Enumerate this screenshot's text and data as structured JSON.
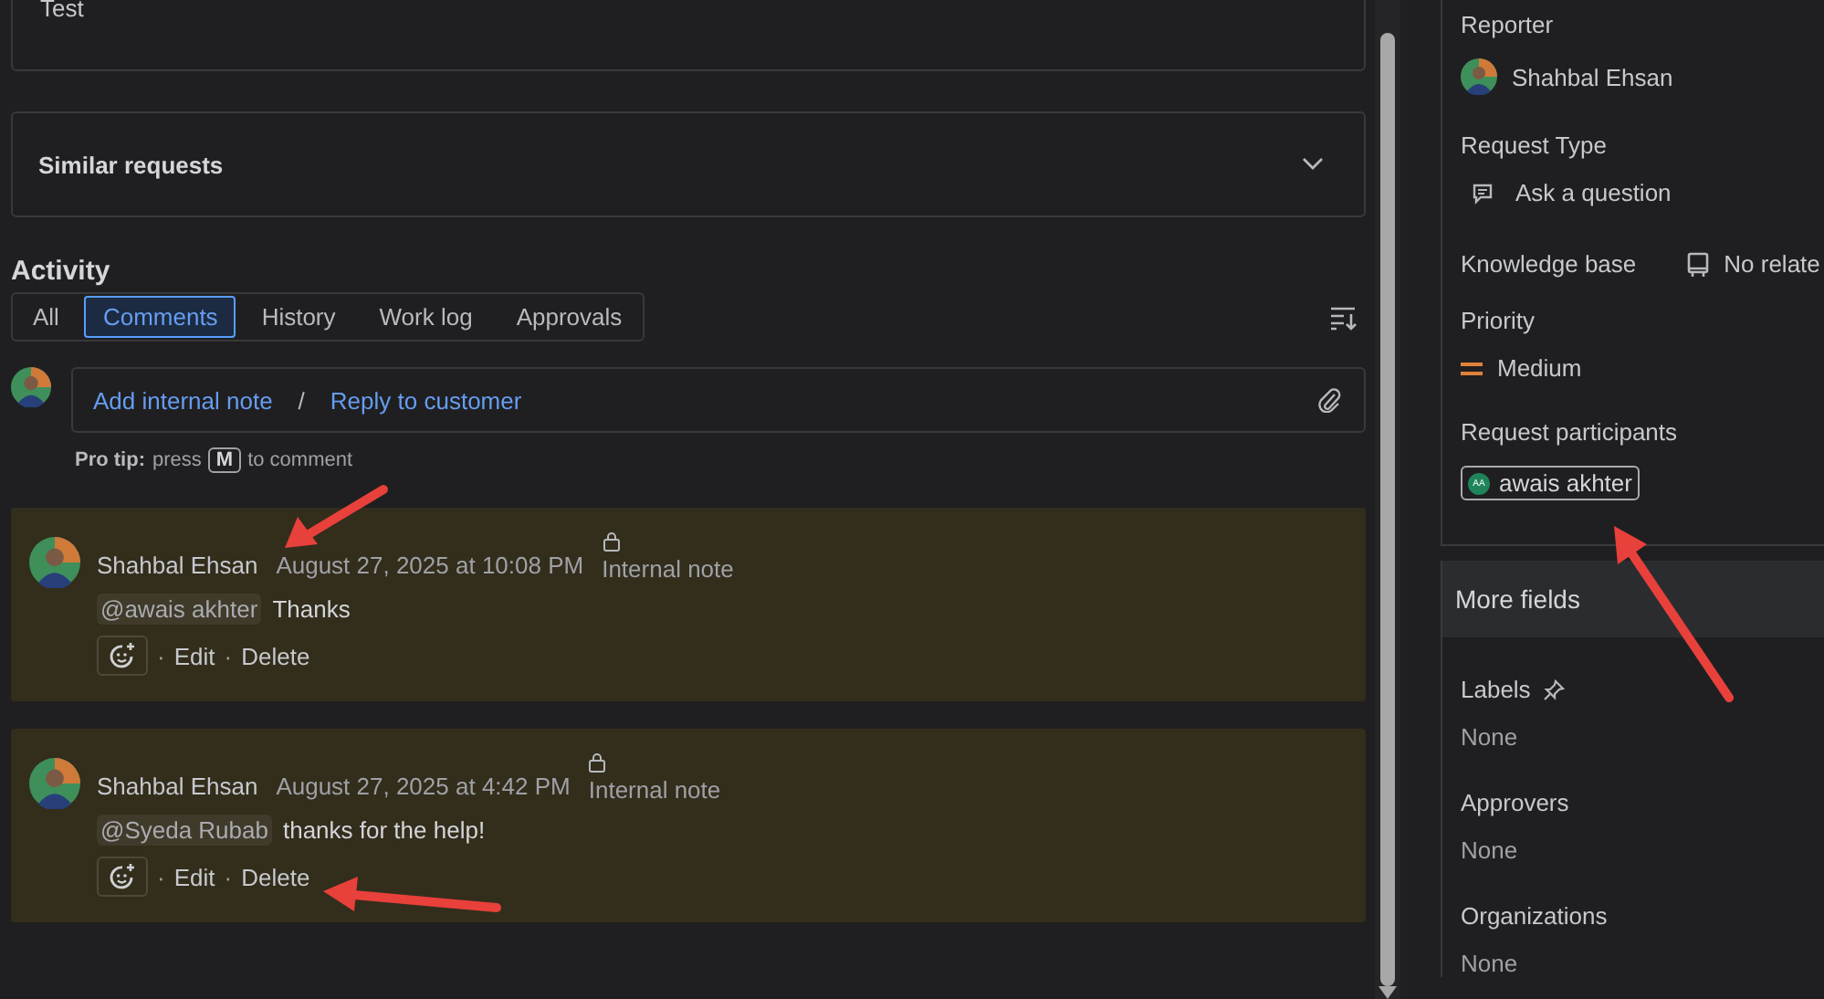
{
  "description_card": {
    "text": "Test"
  },
  "similar_requests": {
    "title": "Similar requests",
    "expanded": false
  },
  "activity": {
    "title": "Activity",
    "tabs": [
      {
        "label": "All",
        "selected": false
      },
      {
        "label": "Comments",
        "selected": true
      },
      {
        "label": "History",
        "selected": false
      },
      {
        "label": "Work log",
        "selected": false
      },
      {
        "label": "Approvals",
        "selected": false
      }
    ]
  },
  "composer": {
    "links": [
      "Add internal note",
      "Reply to customer"
    ],
    "separator": "/",
    "tip_label": "Pro tip:",
    "tip_before": "press",
    "tip_key": "M",
    "tip_after": "to comment"
  },
  "comments": [
    {
      "author": "Shahbal Ehsan",
      "time": "August 27, 2025 at 10:08 PM",
      "visibility": "Internal note",
      "mention": "@awais akhter",
      "text": "Thanks",
      "actions": [
        "Edit",
        "Delete"
      ]
    },
    {
      "author": "Shahbal Ehsan",
      "time": "August 27, 2025 at 4:42 PM",
      "visibility": "Internal note",
      "mention": "@Syeda Rubab",
      "text": "thanks for the help!",
      "actions": [
        "Edit",
        "Delete"
      ]
    }
  ],
  "action_separator": "·",
  "details": {
    "fields": [
      {
        "kind": "person",
        "label": "Reporter",
        "value": "Shahbal Ehsan"
      },
      {
        "kind": "type",
        "label": "Request Type",
        "value": "Ask a question"
      },
      {
        "kind": "inline",
        "label": "Knowledge base",
        "value": "No relate"
      },
      {
        "kind": "priority",
        "label": "Priority",
        "value": "Medium"
      },
      {
        "kind": "participants",
        "label": "Request participants",
        "value": "awais akhter",
        "initials": "AA"
      }
    ]
  },
  "more_fields": {
    "title": "More fields",
    "fields": [
      {
        "label": "Labels",
        "pinned": true,
        "value": "None"
      },
      {
        "label": "Approvers",
        "pinned": false,
        "value": "None"
      },
      {
        "label": "Organizations",
        "pinned": false,
        "value": "None"
      }
    ]
  }
}
